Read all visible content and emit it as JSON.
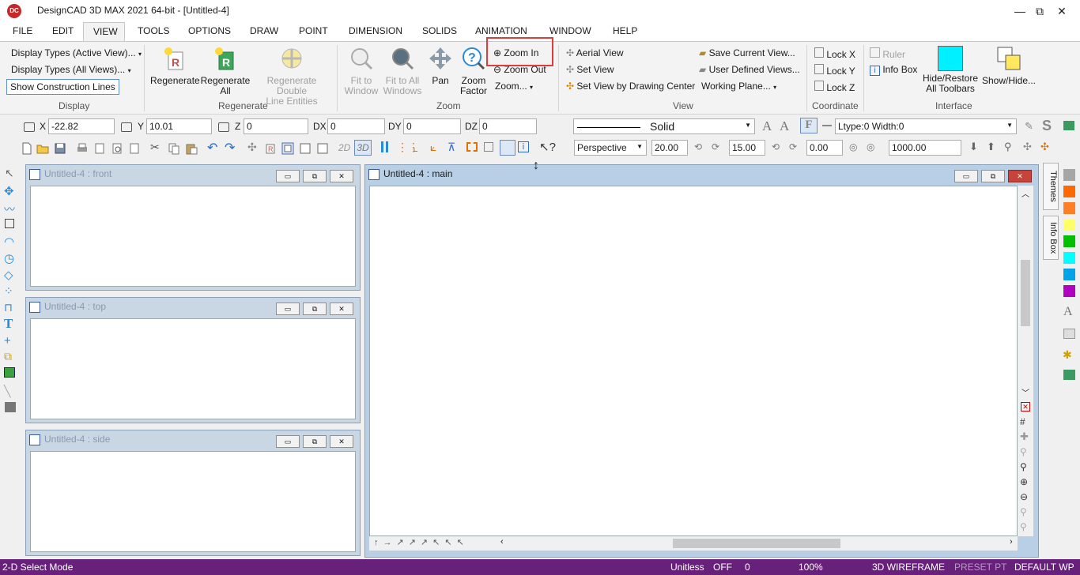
{
  "title_bar": {
    "app_logo": "DC",
    "title": "DesignCAD 3D MAX 2021 64-bit - [Untitled-4]",
    "minimize": "—",
    "restore": "⧉",
    "close": "✕"
  },
  "menu": [
    "FILE",
    "EDIT",
    "VIEW",
    "TOOLS",
    "OPTIONS",
    "DRAW",
    "POINT",
    "DIMENSION",
    "SOLIDS",
    "ANIMATION",
    "WINDOW",
    "HELP"
  ],
  "ribbon": {
    "display": {
      "label": "Display",
      "types_active": "Display Types (Active View)...",
      "types_all": "Display Types (All Views)...",
      "show_construction": "Show Construction Lines"
    },
    "regenerate": {
      "label": "Regenerate",
      "regen_line1": "Regenerate",
      "regen_line2": "",
      "regen_all_line1": "Regenerate",
      "regen_all_line2": "All",
      "regen_double_line1": "Regenerate Double",
      "regen_double_line2": "Line Entities"
    },
    "zoom": {
      "label": "Zoom",
      "fit_window_1": "Fit to",
      "fit_window_2": "Window",
      "fit_all_1": "Fit to All",
      "fit_all_2": "Windows",
      "pan": "Pan",
      "zoom_factor_1": "Zoom",
      "zoom_factor_2": "Factor",
      "zoom_in": "Zoom In",
      "zoom_out": "Zoom Out",
      "zoom_menu": "Zoom..."
    },
    "view": {
      "label": "View",
      "aerial": "Aerial View",
      "set_view": "Set View",
      "set_view_center": "Set View by Drawing Center",
      "save_current": "Save Current View...",
      "user_defined": "User Defined Views...",
      "working_plane": "Working Plane..."
    },
    "coordinate": {
      "label": "Coordinate",
      "lock_x": "Lock X",
      "lock_y": "Lock Y",
      "lock_z": "Lock Z"
    },
    "interface": {
      "label": "Interface",
      "ruler": "Ruler",
      "info_box": "Info Box",
      "hide_restore_1": "Hide/Restore",
      "hide_restore_2": "All Toolbars",
      "show_hide": "Show/Hide..."
    }
  },
  "coords": {
    "x_label": "X",
    "x": "-22.82",
    "y_label": "Y",
    "y": "10.01",
    "z_label": "Z",
    "z": "0",
    "dx_label": "DX",
    "dx": "0",
    "dy_label": "DY",
    "dy": "0",
    "dz_label": "DZ",
    "dz": "0"
  },
  "line_style": {
    "style": "Solid",
    "ltype": "Ltype:0  Width:0"
  },
  "view_toolbar": {
    "mode_2d": "2D",
    "mode_3d": "3D",
    "projection": "Perspective",
    "val1": "20.00",
    "val2": "15.00",
    "val3": "0.00",
    "val4": "1000.00"
  },
  "viewports": {
    "front": "Untitled-4 : front",
    "top": "Untitled-4 : top",
    "side": "Untitled-4 : side",
    "main": "Untitled-4 : main"
  },
  "side_tabs": {
    "themes": "Themes",
    "info_box": "Info Box"
  },
  "palette": [
    "#a6a6a6",
    "#ff6a00",
    "#ff7f27",
    "#ffff66",
    "#00c000",
    "#00ffff",
    "#00a2e8",
    "#b000c0"
  ],
  "status": {
    "mode": "2-D Select Mode",
    "units": "Unitless",
    "snap": "OFF",
    "count": "0",
    "zoom": "100%",
    "render": "3D WIREFRAME",
    "preset": "PRESET PT",
    "wp": "DEFAULT WP"
  }
}
